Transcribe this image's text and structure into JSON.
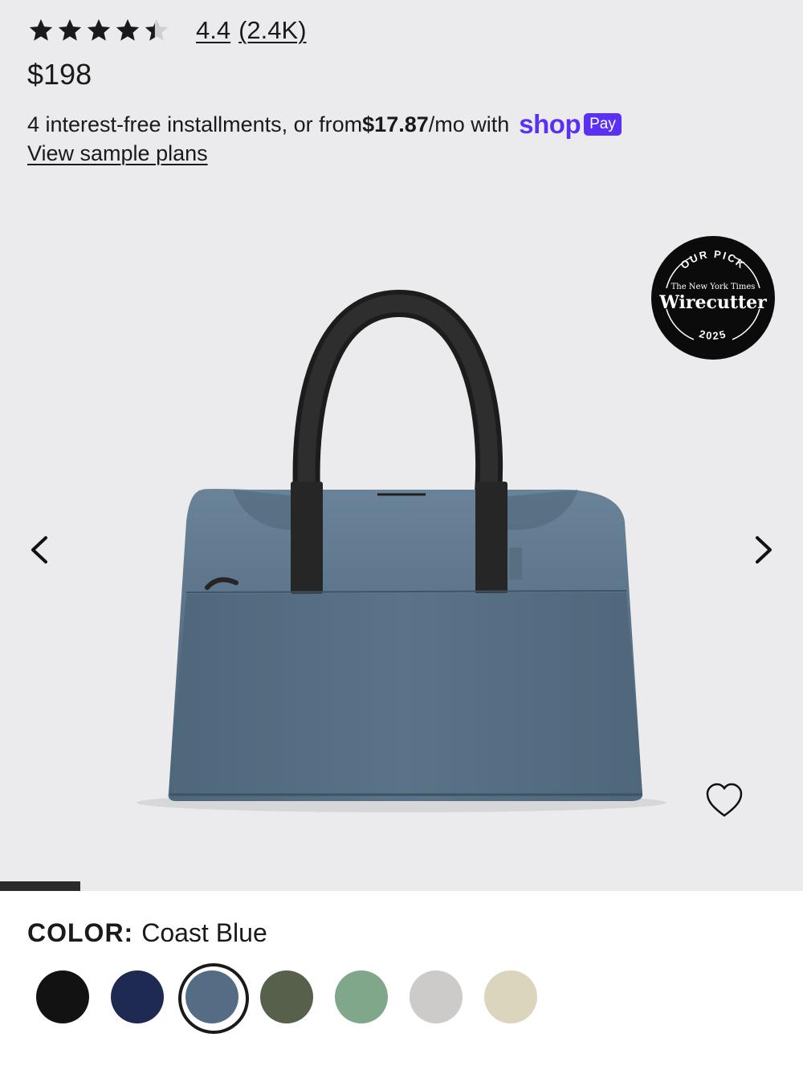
{
  "rating": {
    "stars_value": 4.4,
    "stars_max": 5,
    "score": "4.4",
    "count": "(2.4K)"
  },
  "price": "$198",
  "installments": {
    "prefix": "4 interest-free installments, or from ",
    "amount": "$17.87",
    "suffix": "/mo with",
    "brand_word": "shop",
    "brand_badge": "Pay"
  },
  "view_plans": "View sample plans",
  "badge": {
    "top": "OUR PICK",
    "publisher": "The New York Times",
    "name": "Wirecutter",
    "year": "2025"
  },
  "gallery": {
    "prev_icon": "chevron-left-icon",
    "next_icon": "chevron-right-icon",
    "favorite_icon": "heart-icon",
    "progress_fraction": 0.1
  },
  "color_picker": {
    "label": "COLOR:",
    "selected_name": "Coast Blue",
    "swatches": [
      {
        "color": "#121212"
      },
      {
        "color": "#1f2a52"
      },
      {
        "color": "#546d84",
        "selected": true
      },
      {
        "color": "#56604a"
      },
      {
        "color": "#80a78a"
      },
      {
        "color": "#cdcbc9"
      },
      {
        "color": "#dcd5bd"
      }
    ]
  },
  "colors": {
    "shop_pay": "#5a31f4",
    "bag": "#5a7287",
    "page_bg": "#ebebed"
  }
}
